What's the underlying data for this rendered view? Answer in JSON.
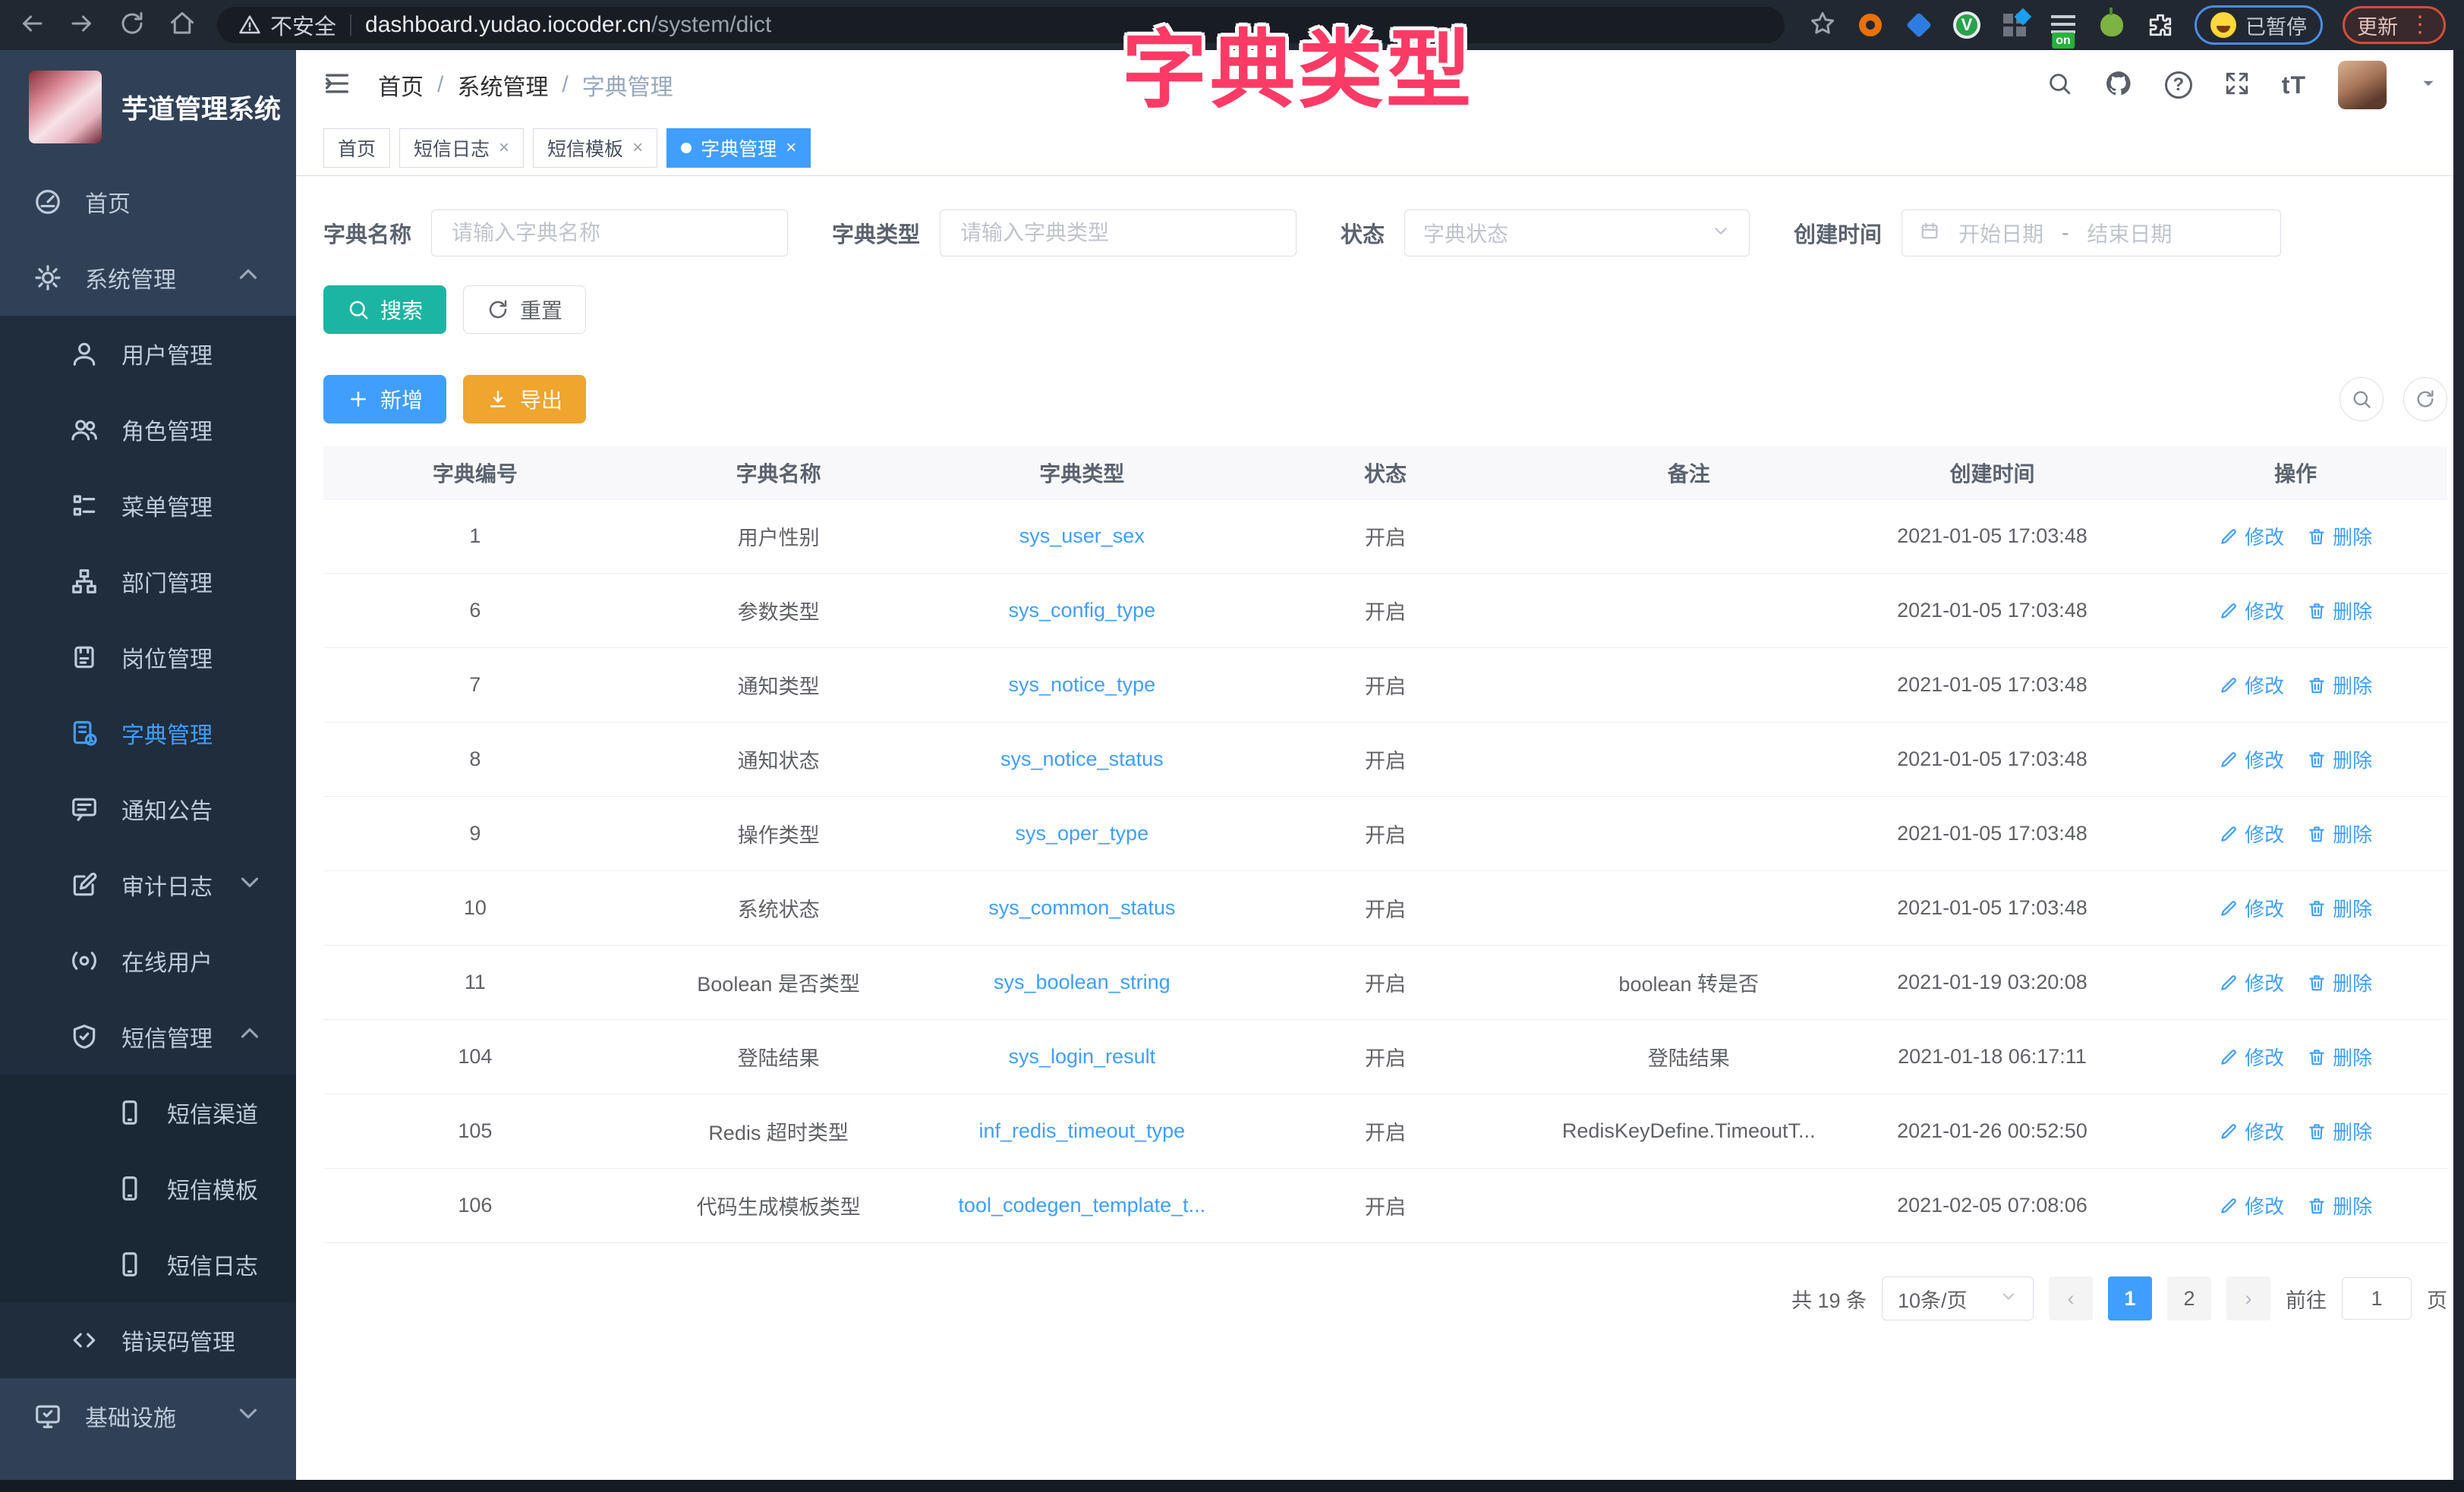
{
  "browser": {
    "security_label": "不安全",
    "url_host": "dashboard.yudao.iocoder.cn",
    "url_path": "/system/dict",
    "on_badge": "on",
    "paused_badge": "已暂停",
    "update_button": "更新"
  },
  "overlay_title": "字典类型",
  "colors": {
    "accent": "#409eff",
    "search_button": "#1cb5a3",
    "export_button": "#efa52e",
    "overlay_pink": "#fb3b66",
    "sidebar_bg": "#304156",
    "submenu_bg": "#1f2d3d"
  },
  "sidebar": {
    "app_title": "芋道管理系统",
    "items": [
      {
        "label": "首页"
      },
      {
        "label": "系统管理"
      },
      {
        "label": "用户管理"
      },
      {
        "label": "角色管理"
      },
      {
        "label": "菜单管理"
      },
      {
        "label": "部门管理"
      },
      {
        "label": "岗位管理"
      },
      {
        "label": "字典管理"
      },
      {
        "label": "通知公告"
      },
      {
        "label": "审计日志"
      },
      {
        "label": "在线用户"
      },
      {
        "label": "短信管理"
      },
      {
        "label": "短信渠道"
      },
      {
        "label": "短信模板"
      },
      {
        "label": "短信日志"
      },
      {
        "label": "错误码管理"
      },
      {
        "label": "基础设施"
      }
    ]
  },
  "breadcrumb": [
    "首页",
    "系统管理",
    "字典管理"
  ],
  "tabs": [
    {
      "label": "首页"
    },
    {
      "label": "短信日志"
    },
    {
      "label": "短信模板"
    },
    {
      "label": "字典管理"
    }
  ],
  "filters": {
    "dict_name_label": "字典名称",
    "dict_name_placeholder": "请输入字典名称",
    "dict_type_label": "字典类型",
    "dict_type_placeholder": "请输入字典类型",
    "status_label": "状态",
    "status_placeholder": "字典状态",
    "create_time_label": "创建时间",
    "date_start_placeholder": "开始日期",
    "date_separator": "-",
    "date_end_placeholder": "结束日期",
    "search_label": "搜索",
    "reset_label": "重置"
  },
  "toolbar": {
    "add_label": "新增",
    "export_label": "导出"
  },
  "table": {
    "columns": [
      "字典编号",
      "字典名称",
      "字典类型",
      "状态",
      "备注",
      "创建时间",
      "操作"
    ],
    "edit_label": "修改",
    "delete_label": "删除",
    "rows": [
      {
        "id": "1",
        "name": "用户性别",
        "type": "sys_user_sex",
        "status": "开启",
        "remark": "",
        "created": "2021-01-05 17:03:48"
      },
      {
        "id": "6",
        "name": "参数类型",
        "type": "sys_config_type",
        "status": "开启",
        "remark": "",
        "created": "2021-01-05 17:03:48"
      },
      {
        "id": "7",
        "name": "通知类型",
        "type": "sys_notice_type",
        "status": "开启",
        "remark": "",
        "created": "2021-01-05 17:03:48"
      },
      {
        "id": "8",
        "name": "通知状态",
        "type": "sys_notice_status",
        "status": "开启",
        "remark": "",
        "created": "2021-01-05 17:03:48"
      },
      {
        "id": "9",
        "name": "操作类型",
        "type": "sys_oper_type",
        "status": "开启",
        "remark": "",
        "created": "2021-01-05 17:03:48"
      },
      {
        "id": "10",
        "name": "系统状态",
        "type": "sys_common_status",
        "status": "开启",
        "remark": "",
        "created": "2021-01-05 17:03:48"
      },
      {
        "id": "11",
        "name": "Boolean 是否类型",
        "type": "sys_boolean_string",
        "status": "开启",
        "remark": "boolean 转是否",
        "created": "2021-01-19 03:20:08"
      },
      {
        "id": "104",
        "name": "登陆结果",
        "type": "sys_login_result",
        "status": "开启",
        "remark": "登陆结果",
        "created": "2021-01-18 06:17:11"
      },
      {
        "id": "105",
        "name": "Redis 超时类型",
        "type": "inf_redis_timeout_type",
        "status": "开启",
        "remark": "RedisKeyDefine.TimeoutT...",
        "created": "2021-01-26 00:52:50"
      },
      {
        "id": "106",
        "name": "代码生成模板类型",
        "type": "tool_codegen_template_t...",
        "status": "开启",
        "remark": "",
        "created": "2021-02-05 07:08:06"
      }
    ]
  },
  "pagination": {
    "total_text": "共 19 条",
    "page_size": "10条/页",
    "page_1": "1",
    "page_2": "2",
    "goto_label": "前往",
    "goto_value": "1",
    "page_unit": "页"
  }
}
